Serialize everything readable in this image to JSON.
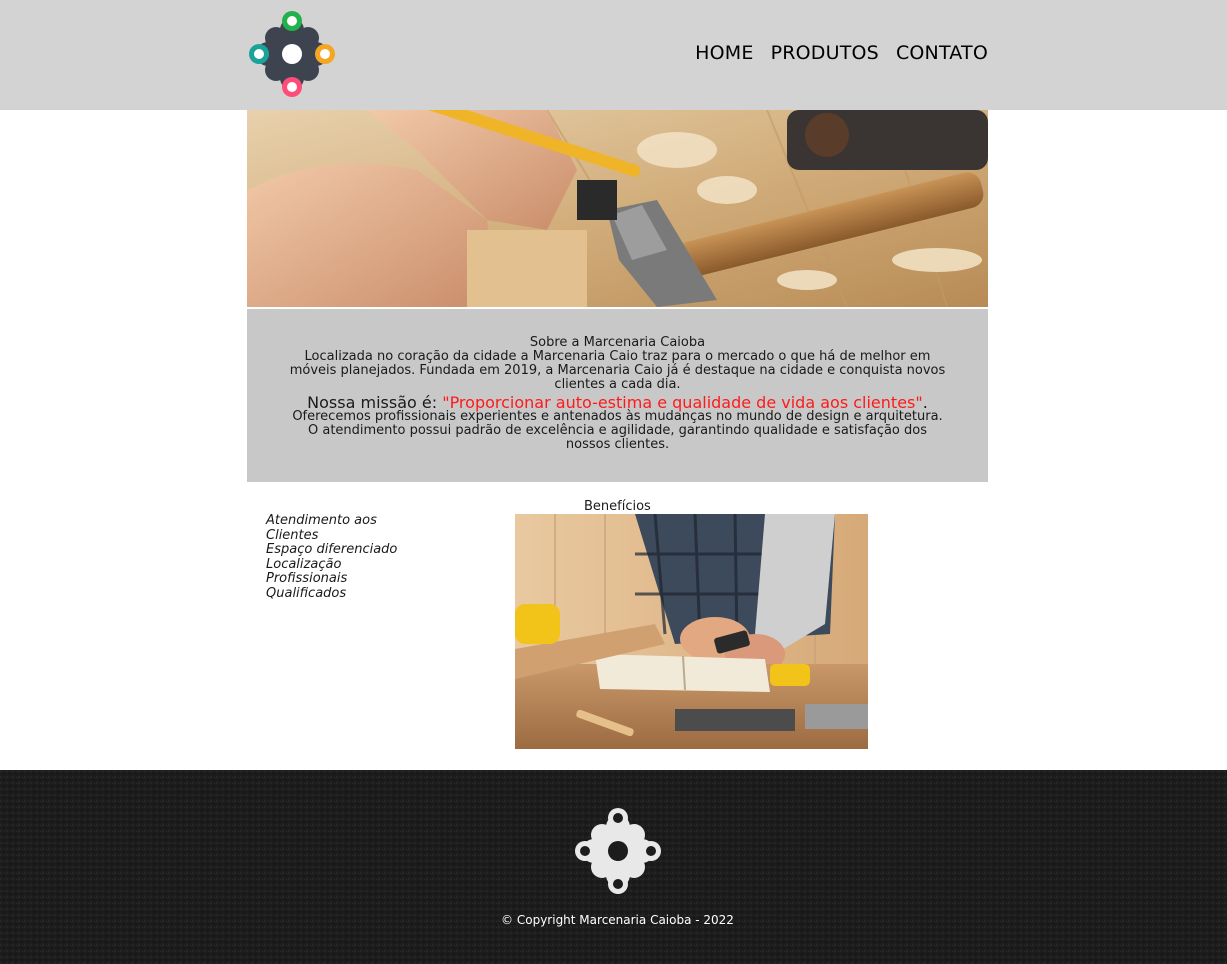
{
  "colors": {
    "header_bg": "#d3d3d3",
    "about_bg": "#c8c8c8",
    "mission_quote": "#ff1a1a",
    "footer_bg": "#1c1c1c",
    "logo_green": "#22b14c",
    "logo_orange": "#f5a623",
    "logo_pink": "#ff4d7a",
    "logo_teal": "#1aa39a",
    "logo_dark": "#3d4450"
  },
  "header": {
    "logo_icon": "flower-logo-icon",
    "nav": [
      {
        "label": "HOME"
      },
      {
        "label": "PRODUTOS"
      },
      {
        "label": "CONTATO"
      }
    ]
  },
  "hero": {
    "image": "carpenter-measuring-wood-photo"
  },
  "about": {
    "title": "Sobre a Marcenaria Caioba",
    "text": "Localizada no coração da cidade a Marcenaria Caio traz para o mercado o que há de melhor em móveis planejados. Fundada em 2019, a Marcenaria Caio já é destaque na cidade e conquista novos clientes a cada dia.",
    "mission_prefix": "Nossa missão é: ",
    "mission_quote": "\"Proporcionar auto-estima e qualidade de vida aos clientes\"",
    "mission_suffix": ".",
    "offer": "Oferecemos profissionais experientes e antenados às mudanças no mundo de design e arquitetura. O atendimento possui padrão de excelência e agilidade, garantindo qualidade e satisfação dos nossos clientes."
  },
  "benefits": {
    "title": "Benefícios",
    "items": [
      "Atendimento aos Clientes",
      "Espaço diferenciado",
      "Localização",
      "Profissionais Qualificados"
    ],
    "image": "carpenter-with-phone-workbench-photo"
  },
  "footer": {
    "logo_icon": "flower-logo-icon",
    "copyright": "© Copyright Marcenaria Caioba - 2022"
  }
}
